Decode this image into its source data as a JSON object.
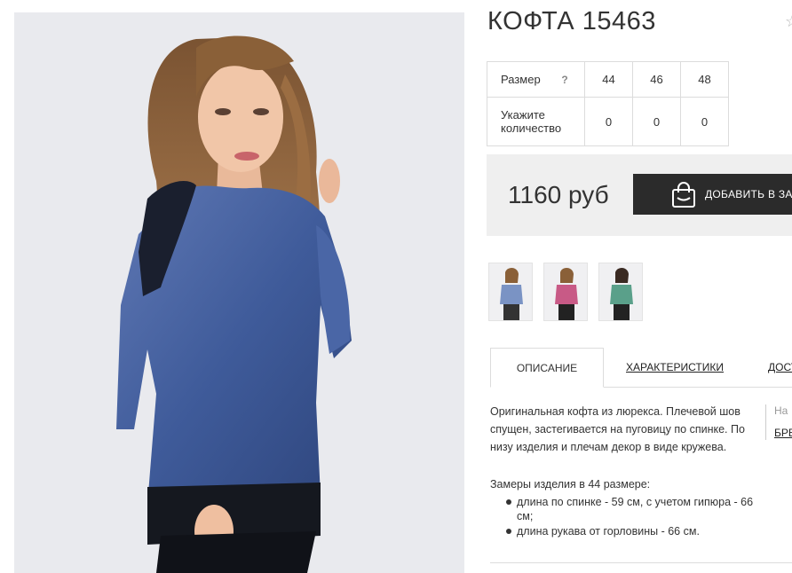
{
  "product": {
    "title": "КОФТА 15463",
    "star_icon": "star-icon"
  },
  "sizes": {
    "size_label": "Размер",
    "help": "?",
    "qty_label_line1": "Укажите",
    "qty_label_line2": "количество",
    "items": [
      {
        "size": "44",
        "qty": "0"
      },
      {
        "size": "46",
        "qty": "0"
      },
      {
        "size": "48",
        "qty": "0"
      }
    ]
  },
  "price": {
    "value": "1160 руб",
    "cart_button": "ДОБАВИТЬ В ЗА",
    "cart_icon": "shopping-bag-icon"
  },
  "thumbnails": [
    {
      "name": "blue",
      "color": "#7a93c4"
    },
    {
      "name": "pink",
      "color": "#c85a86"
    },
    {
      "name": "green",
      "color": "#5aa08a"
    }
  ],
  "tabs": {
    "description": "ОПИСАНИЕ",
    "characteristics": "ХАРАКТЕРИСТИКИ",
    "delivery": "ДОСТ"
  },
  "description": {
    "text": "Оригинальная кофта из люрекса. Плечевой шов спущен, застегивается на пуговицу по спинке. По низу изделия и плечам декор в виде кружева.",
    "side_text": "На",
    "side_link": "БРЕ",
    "measurements_title": "Замеры изделия в 44 размере:",
    "measurements": [
      "длина по спинке - 59 см, с учетом гипюра - 66 см;",
      "длина рукава от горловины - 66 см."
    ]
  },
  "colors": {
    "button_bg": "#2b2b2b",
    "price_bg": "#efefef",
    "photo_bg": "#e9eaee",
    "sweater": "#3f5b9a"
  }
}
